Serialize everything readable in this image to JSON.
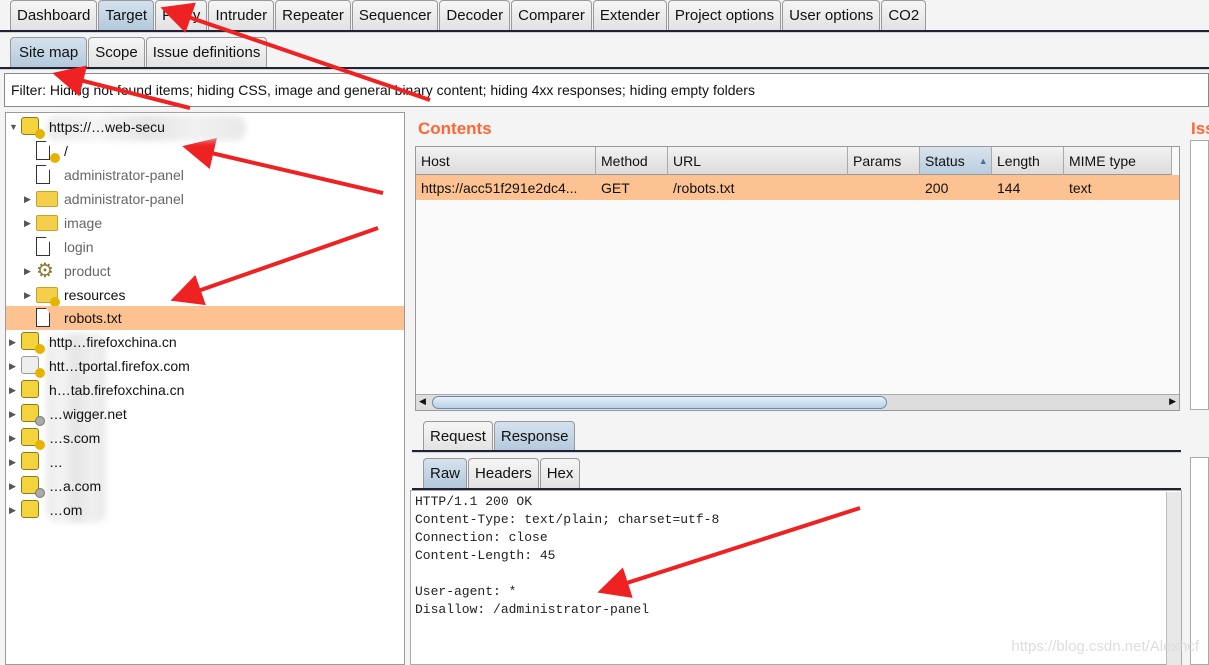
{
  "top_tabs": [
    "Dashboard",
    "Target",
    "Proxy",
    "Intruder",
    "Repeater",
    "Sequencer",
    "Decoder",
    "Comparer",
    "Extender",
    "Project options",
    "User options",
    "CO2"
  ],
  "top_tabs_active": "Target",
  "sub_tabs": [
    "Site map",
    "Scope",
    "Issue definitions"
  ],
  "sub_tabs_active": "Site map",
  "filter": "Filter: Hiding not found items;  hiding CSS, image and general binary content;  hiding 4xx responses;  hiding empty folders",
  "tree": {
    "root": "https://…web-secu",
    "children": [
      {
        "label": "/",
        "icon": "file-icon"
      },
      {
        "label": "administrator-panel",
        "icon": "file-icon"
      },
      {
        "label": "administrator-panel",
        "icon": "folder-icon"
      },
      {
        "label": "image",
        "icon": "folder-icon"
      },
      {
        "label": "login",
        "icon": "file-icon"
      },
      {
        "label": "product",
        "icon": "gear-icon"
      },
      {
        "label": "resources",
        "icon": "folder-icon"
      },
      {
        "label": "robots.txt",
        "icon": "file-icon",
        "selected": true
      }
    ],
    "hosts": [
      "http…firefoxchina.cn",
      "htt…tportal.firefox.com",
      "h…tab.firefoxchina.cn",
      "…wigger.net",
      "…s.com",
      "…",
      "…a.com",
      "…om"
    ]
  },
  "contents": {
    "title": "Contents",
    "columns": [
      "Host",
      "Method",
      "URL",
      "Params",
      "Status",
      "Length",
      "MIME type"
    ],
    "sorted_column": "Status",
    "rows": [
      {
        "host": "https://acc51f291e2dc4...",
        "method": "GET",
        "url": "/robots.txt",
        "params": "",
        "status": "200",
        "length": "144",
        "mime": "text"
      }
    ]
  },
  "issues_title": "Iss",
  "message_tabs": [
    "Request",
    "Response"
  ],
  "message_tab_active": "Response",
  "view_tabs": [
    "Raw",
    "Headers",
    "Hex"
  ],
  "view_tab_active": "Raw",
  "response_lines": [
    "HTTP/1.1 200 OK",
    "Content-Type: text/plain; charset=utf-8",
    "Connection: close",
    "Content-Length: 45",
    "",
    "User-agent: *",
    "Disallow: /administrator-panel"
  ],
  "watermark": "https://blog.csdn.net/Alexhcf",
  "colors": {
    "accent": "#ff6633",
    "selected_row": "#fdc292",
    "arrow": "#ee2222"
  }
}
